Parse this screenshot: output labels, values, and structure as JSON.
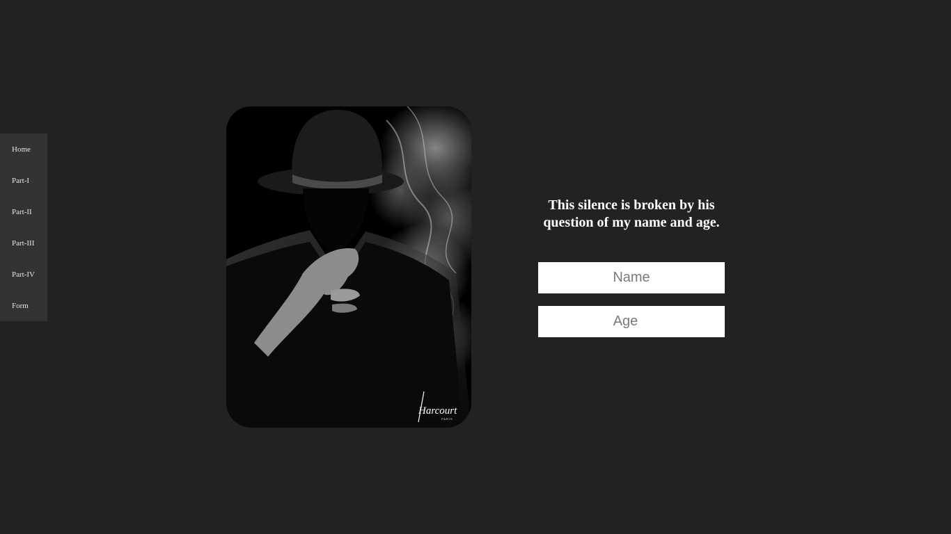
{
  "nav": {
    "items": [
      {
        "label": "Home"
      },
      {
        "label": "Part-I"
      },
      {
        "label": "Part-II"
      },
      {
        "label": "Part-III"
      },
      {
        "label": "Part-IV"
      },
      {
        "label": "Form"
      }
    ]
  },
  "photo": {
    "watermark": "Harcourt",
    "watermark_sub": "PARIS"
  },
  "form": {
    "question": "This silence is broken by his question of my name and age.",
    "name_placeholder": "Name",
    "name_value": "",
    "age_placeholder": "Age",
    "age_value": ""
  }
}
